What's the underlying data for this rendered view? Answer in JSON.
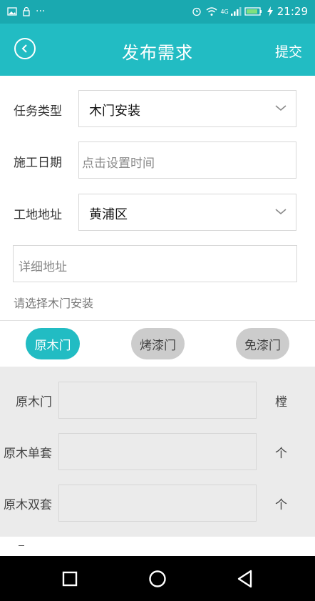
{
  "status_bar": {
    "dots": "···",
    "network_label": "4G",
    "time": "21:29"
  },
  "header": {
    "title": "发布需求",
    "submit_label": "提交"
  },
  "form": {
    "task_type": {
      "label": "任务类型",
      "value": "木门安装"
    },
    "construction_date": {
      "label": "施工日期",
      "placeholder": "点击设置时间"
    },
    "site_address": {
      "label": "工地地址",
      "value": "黄浦区"
    },
    "detail_address": {
      "placeholder": "详细地址"
    },
    "hint": "请选择木门安装"
  },
  "door_types": [
    {
      "label": "原木门",
      "selected": true
    },
    {
      "label": "烤漆门",
      "selected": false
    },
    {
      "label": "免漆门",
      "selected": false
    }
  ],
  "quantities": [
    {
      "label": "原木门",
      "unit": "樘",
      "value": ""
    },
    {
      "label": "原木单套",
      "unit": "个",
      "value": ""
    },
    {
      "label": "原木双套",
      "unit": "个",
      "value": ""
    }
  ],
  "colors": {
    "accent": "#22bcc3",
    "statusbar": "#1aa9b0"
  },
  "icons": {
    "back": "chevron-left-circle-icon",
    "dropdown": "chevron-down-icon",
    "nav_back": "triangle-back-icon",
    "nav_home": "circle-home-icon",
    "nav_recent": "square-recent-icon"
  }
}
